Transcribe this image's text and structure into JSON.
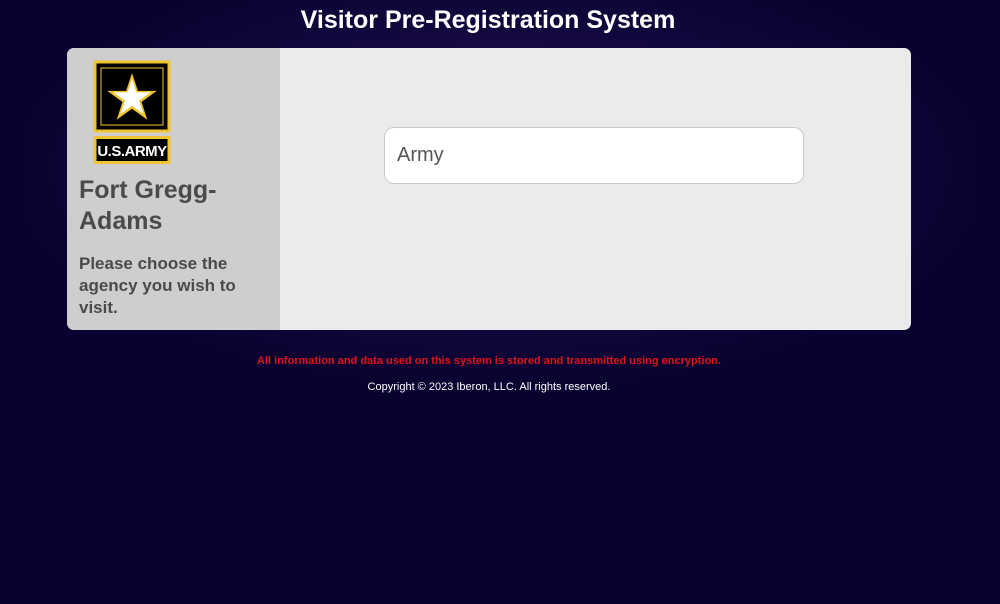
{
  "header": {
    "title": "Visitor Pre-Registration System"
  },
  "sidebar": {
    "logo": {
      "icon": "us-army-star-logo",
      "text": "U.S.ARMY",
      "colors": {
        "border": "#f0c430",
        "background": "#000000",
        "star": "#ffffff"
      }
    },
    "site_name": "Fort Gregg-Adams",
    "instruction": "Please choose the agency you wish to visit."
  },
  "agency_selection": {
    "options": [
      "Army"
    ]
  },
  "footer": {
    "security_notice": "All information and data used on this system is stored and transmitted using encryption.",
    "copyright": "Copyright © 2023 Iberon, LLC. All rights reserved."
  },
  "colors": {
    "page_background": "#07022f",
    "card_background": "#ebebeb",
    "sidebar_background": "#cecece",
    "notice": "#e01414"
  }
}
